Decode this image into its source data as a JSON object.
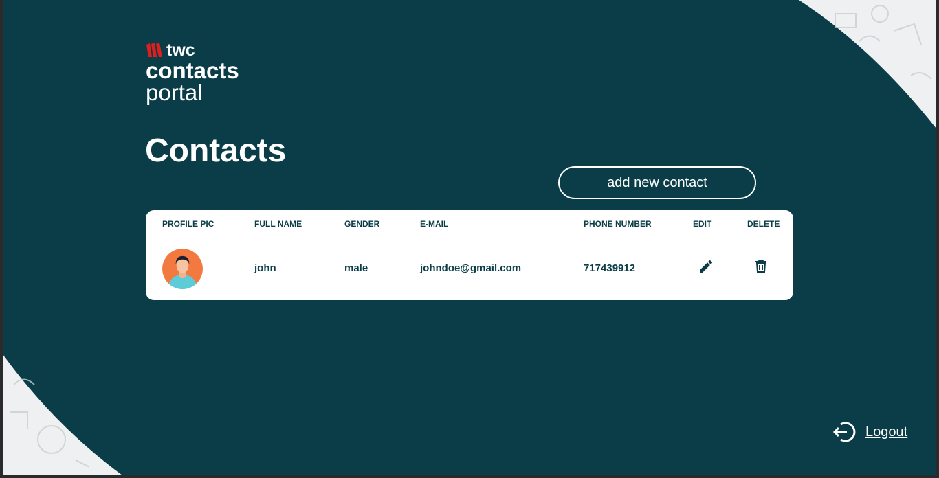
{
  "colors": {
    "background": "#0a3d48",
    "card": "#ffffff",
    "text_dark": "#0a3d48",
    "brand_red": "#e11d1d",
    "avatar_bg": "#f2793f",
    "avatar_shirt": "#5ccdd8"
  },
  "logo": {
    "brand": "twc",
    "line1": "contacts",
    "line2": "portal"
  },
  "page_title": "Contacts",
  "actions": {
    "add_label": "add new contact"
  },
  "table": {
    "headers": {
      "profile_pic": "PROFILE PIC",
      "full_name": "FULL NAME",
      "gender": "GENDER",
      "email": "E-MAIL",
      "phone": "PHONE NUMBER",
      "edit": "EDIT",
      "delete": "DELETE"
    },
    "rows": [
      {
        "full_name": "john",
        "gender": "male",
        "email": "johndoe@gmail.com",
        "phone": "717439912",
        "edit_icon": "pencil-icon",
        "delete_icon": "trash-icon"
      }
    ]
  },
  "logout": {
    "label": "Logout",
    "icon": "logout-arrow-icon"
  }
}
